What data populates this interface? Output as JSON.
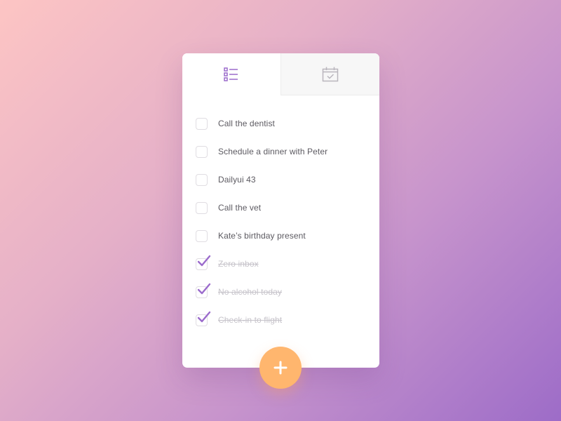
{
  "app": {
    "colors": {
      "accent": "#9b6bcc",
      "fab": "#ffb66e",
      "text": "#5c5a61",
      "done_text": "#c6c3ca"
    }
  },
  "tabs": [
    {
      "icon": "list-icon",
      "active": true
    },
    {
      "icon": "calendar-check-icon",
      "active": false
    }
  ],
  "todos": [
    {
      "label": "Call the dentist",
      "done": false
    },
    {
      "label": "Schedule a dinner with Peter",
      "done": false
    },
    {
      "label": "Dailyui 43",
      "done": false
    },
    {
      "label": "Call the vet",
      "done": false
    },
    {
      "label": "Kate’s birthday present",
      "done": false
    },
    {
      "label": "Zero inbox",
      "done": true
    },
    {
      "label": "No alcohol today",
      "done": true
    },
    {
      "label": "Check-in to flight",
      "done": true
    }
  ],
  "fab": {
    "icon": "plus-icon"
  }
}
